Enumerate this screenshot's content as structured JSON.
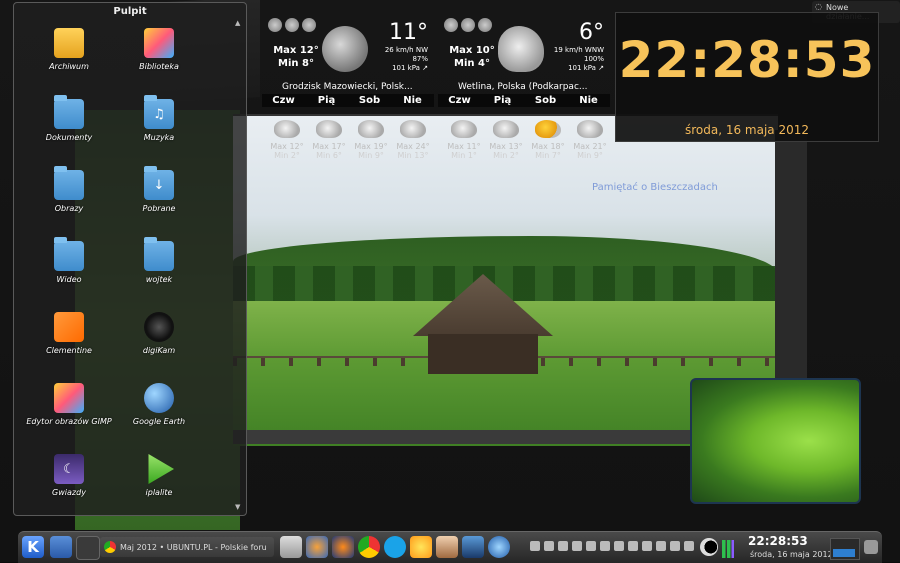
{
  "folderview": {
    "title": "Pulpit",
    "items": [
      {
        "label": "Archiwum",
        "icon": "archive-folder-icon"
      },
      {
        "label": "Biblioteka",
        "icon": "library-icon"
      },
      {
        "label": "Dokumenty",
        "icon": "documents-folder-icon"
      },
      {
        "label": "Muzyka",
        "icon": "music-folder-icon"
      },
      {
        "label": "Obrazy",
        "icon": "pictures-folder-icon"
      },
      {
        "label": "Pobrane",
        "icon": "downloads-folder-icon"
      },
      {
        "label": "Wideo",
        "icon": "video-folder-icon"
      },
      {
        "label": "wojtek",
        "icon": "home-folder-icon"
      },
      {
        "label": "Clementine",
        "icon": "clementine-icon"
      },
      {
        "label": "digiKam",
        "icon": "digikam-icon"
      },
      {
        "label": "Edytor obrazów GIMP",
        "icon": "gimp-icon"
      },
      {
        "label": "Google Earth",
        "icon": "google-earth-icon"
      },
      {
        "label": "Gwiazdy",
        "icon": "stars-icon"
      },
      {
        "label": "iplalite",
        "icon": "iplalite-icon"
      }
    ]
  },
  "weather1": {
    "max": "Max 12°",
    "min": "Min 8°",
    "temp": "11°",
    "wind": "26 km/h NW",
    "humidity": "87%",
    "pressure": "101 kPa ↗",
    "location": "Grodzisk Mazowiecki, Polsk...",
    "days": [
      "Czw",
      "Pią",
      "Sob",
      "Nie"
    ],
    "forecast": [
      {
        "max": "Max 12°",
        "min": "Min 2°"
      },
      {
        "max": "Max 17°",
        "min": "Min 6°"
      },
      {
        "max": "Max 19°",
        "min": "Min 9°"
      },
      {
        "max": "Max 24°",
        "min": "Min 13°"
      }
    ]
  },
  "weather2": {
    "max": "Max 10°",
    "min": "Min 4°",
    "temp": "6°",
    "wind": "19 km/h WNW",
    "humidity": "100%",
    "pressure": "101 kPa ↗",
    "location": "Wetlina, Polska (Podkarpac...",
    "days": [
      "Czw",
      "Pią",
      "Sob",
      "Nie"
    ],
    "forecast": [
      {
        "max": "Max 11°",
        "min": "Min 1°"
      },
      {
        "max": "Max 13°",
        "min": "Min 2°"
      },
      {
        "max": "Max 18°",
        "min": "Min 7°"
      },
      {
        "max": "Max 21°",
        "min": "Min 9°"
      }
    ]
  },
  "memory_caption": "Pamiętać o Bieszczadach",
  "clock": {
    "time": "22:28:53",
    "date": "środa, 16 maja 2012"
  },
  "news": {
    "label": "Nowe działanie..."
  },
  "taskbar": {
    "task_label": "Maj 2012 • UBUNTU.PL - Polskie foru",
    "time": "22:28:53",
    "date": "środa, 16 maja 2012"
  }
}
